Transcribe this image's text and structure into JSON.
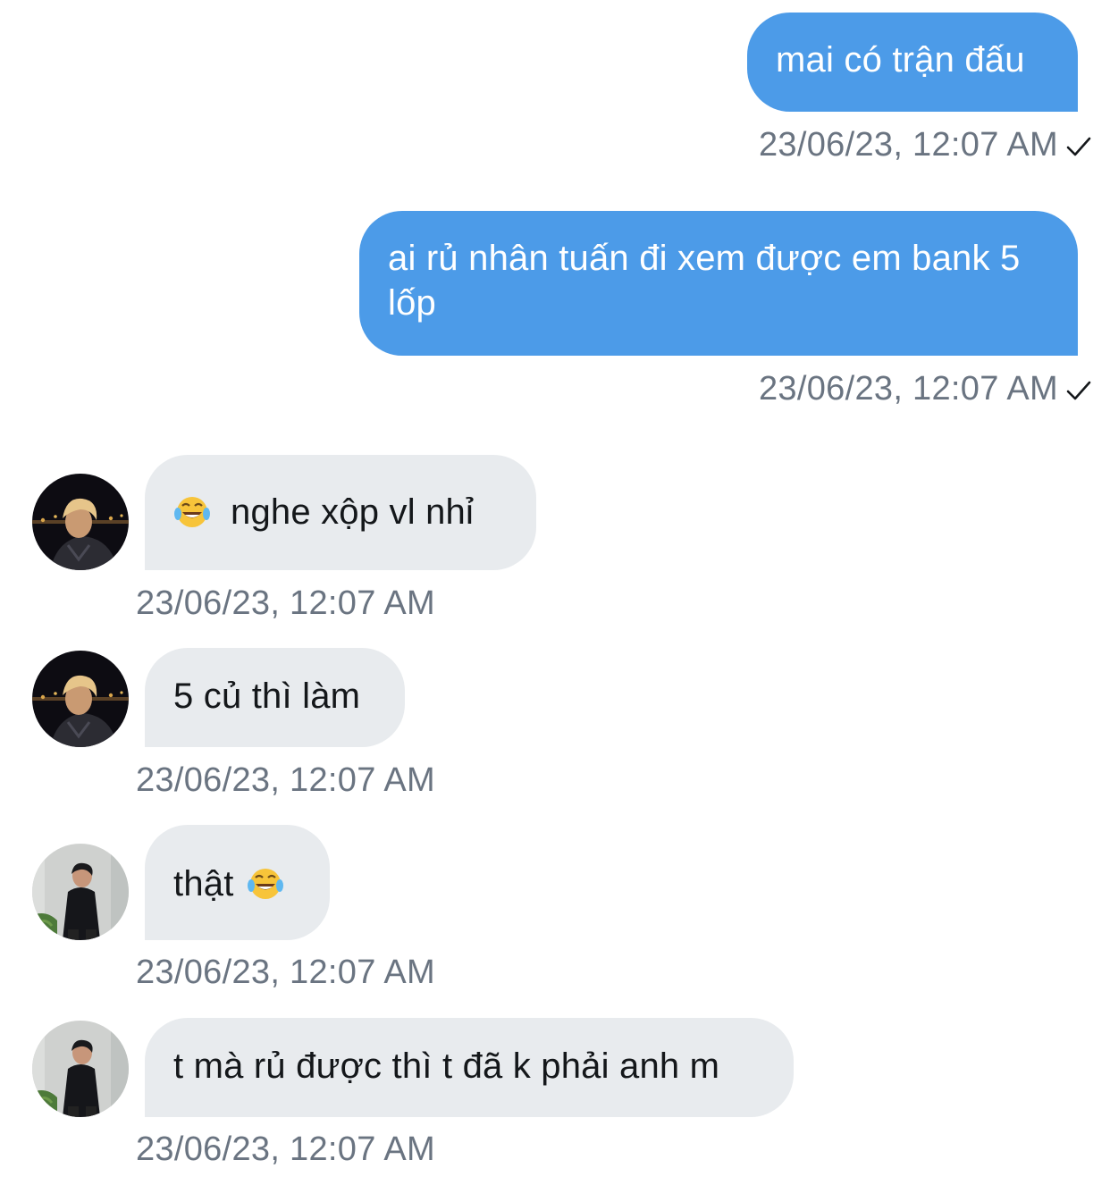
{
  "messages": [
    {
      "direction": "out",
      "text": "mai có trận đấu",
      "timestamp": "23/06/23, 12:07 AM",
      "status_icon": "check-icon"
    },
    {
      "direction": "out",
      "text": "ai rủ nhân tuấn đi xem được em bank 5 lốp",
      "timestamp": "23/06/23, 12:07 AM",
      "status_icon": "check-icon"
    },
    {
      "direction": "in",
      "sender_avatar": "avatar-blond",
      "emoji": "face-with-tears-of-joy",
      "text": "nghe xộp vl nhỉ",
      "timestamp": "23/06/23, 12:07 AM"
    },
    {
      "direction": "in",
      "sender_avatar": "avatar-blond",
      "text": "5 củ thì làm",
      "timestamp": "23/06/23, 12:07 AM"
    },
    {
      "direction": "in",
      "sender_avatar": "avatar-dark-shirt",
      "text": "thật",
      "emoji_after": "face-with-tears-of-joy",
      "timestamp": "23/06/23, 12:07 AM"
    },
    {
      "direction": "in",
      "sender_avatar": "avatar-dark-shirt",
      "text": "t mà rủ được thì t đã k phải anh m",
      "timestamp": "23/06/23, 12:07 AM"
    }
  ],
  "colors": {
    "outgoing_bubble": "#4c9be8",
    "incoming_bubble": "#e8ebee",
    "timestamp_text": "#6a7481"
  }
}
